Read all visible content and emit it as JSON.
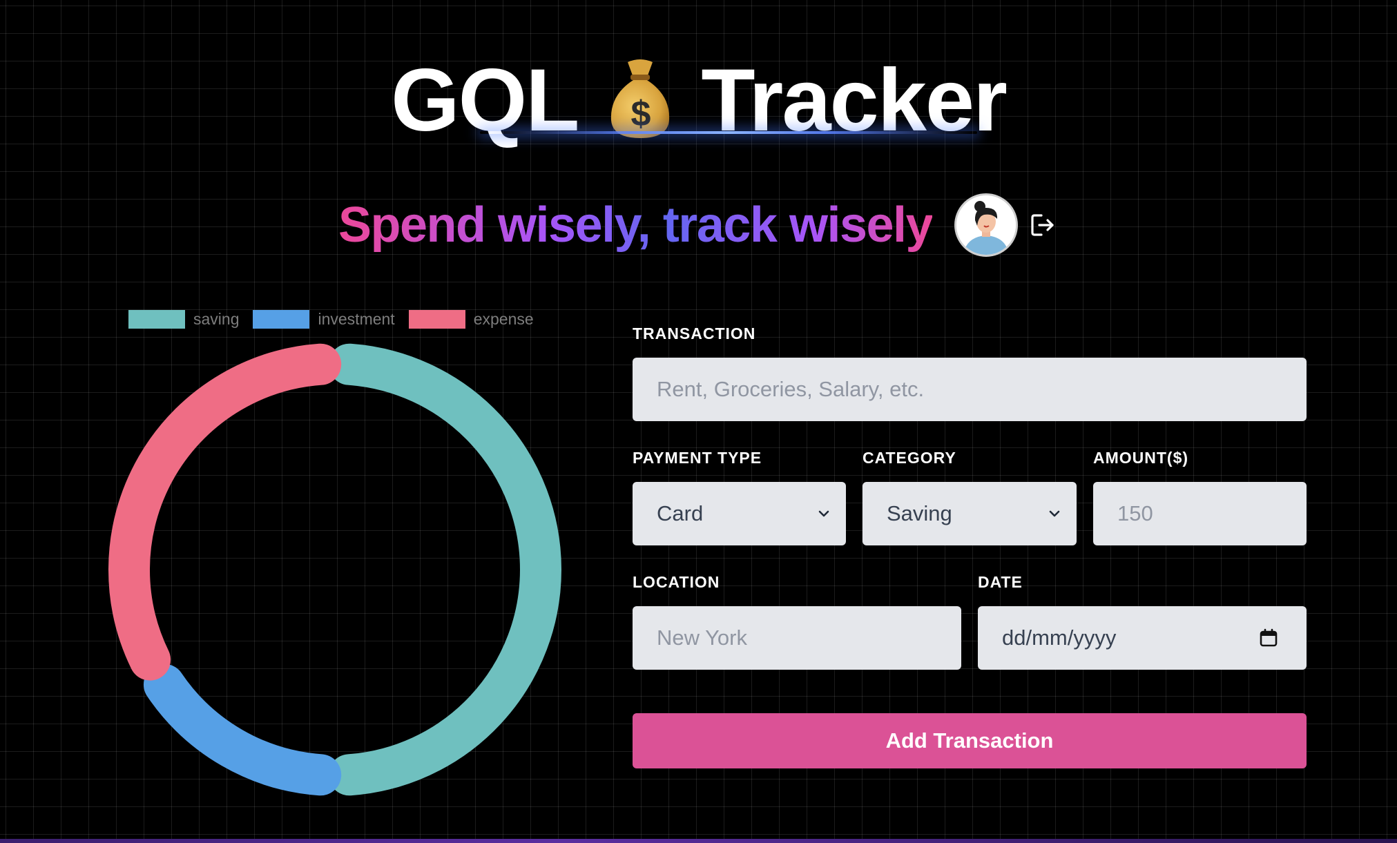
{
  "header": {
    "title_left": "GQL",
    "title_right": "Tracker",
    "title_icon": "money-bag-icon",
    "subtitle": "Spend wisely, track wisely",
    "avatar_icon": "user-avatar",
    "logout_icon": "logout-icon"
  },
  "colors": {
    "saving": "#6fc0bf",
    "investment": "#56a0e6",
    "expense": "#ef6d85",
    "button": "#db5296"
  },
  "chart_data": {
    "type": "doughnut",
    "legend_position": "top",
    "series": [
      {
        "name": "saving",
        "values": [
          3
        ]
      },
      {
        "name": "investment",
        "values": [
          1
        ]
      },
      {
        "name": "expense",
        "values": [
          2
        ]
      }
    ],
    "categories": [
      "saving",
      "investment",
      "expense"
    ],
    "values": [
      3,
      1,
      2
    ],
    "colors": [
      "#6fc0bf",
      "#56a0e6",
      "#ef6d85"
    ]
  },
  "form": {
    "transaction": {
      "label": "TRANSACTION",
      "placeholder": "Rent, Groceries, Salary, etc."
    },
    "payment_type": {
      "label": "PAYMENT TYPE",
      "value": "Card"
    },
    "category": {
      "label": "CATEGORY",
      "value": "Saving"
    },
    "amount": {
      "label": "AMOUNT($)",
      "placeholder": "150"
    },
    "location": {
      "label": "LOCATION",
      "placeholder": "New York"
    },
    "date": {
      "label": "DATE",
      "placeholder": "dd/mm/yyyy",
      "icon": "calendar-icon"
    },
    "submit_label": "Add Transaction"
  }
}
